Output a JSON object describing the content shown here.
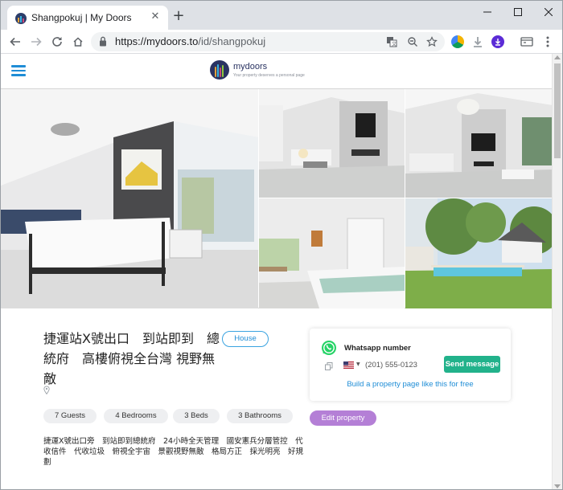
{
  "browser": {
    "tab_title": "Shangpokuj | My Doors",
    "url_host": "https://mydoors.to",
    "url_path": "/id/shangpokuj",
    "icons": [
      "back-icon",
      "forward-icon",
      "reload-icon",
      "home-icon",
      "lock-icon",
      "translate-icon",
      "zoom-icon",
      "star-icon",
      "extension-icon",
      "download-icon",
      "menu-icon"
    ]
  },
  "site": {
    "brand_name": "mydoors",
    "tagline": "Your property deserves a personal page"
  },
  "property": {
    "title": "捷運站X號出口　到站即到　總統府　高樓俯視全台灣 視野無敵",
    "type": "House",
    "features": [
      "7 Guests",
      "4 Bedrooms",
      "3 Beds",
      "3 Bathrooms"
    ],
    "description": "捷運X號出口旁　到站即到總統府　24小時全天管理　國安憲兵分層管控　代收信件　代收垃圾　俯視全宇宙　景觀視野無敵　格局方正　採光明亮　好規劃"
  },
  "contact": {
    "label": "Whatsapp number",
    "phone": "(201) 555-0123",
    "send_label": "Send message",
    "build_link": "Build a property page like this for free"
  },
  "actions": {
    "edit_label": "Edit property"
  },
  "colors": {
    "accent": "#1f8dd6",
    "whatsapp": "#22b28b",
    "edit": "#b47fd6",
    "brand": "#2a3362"
  }
}
